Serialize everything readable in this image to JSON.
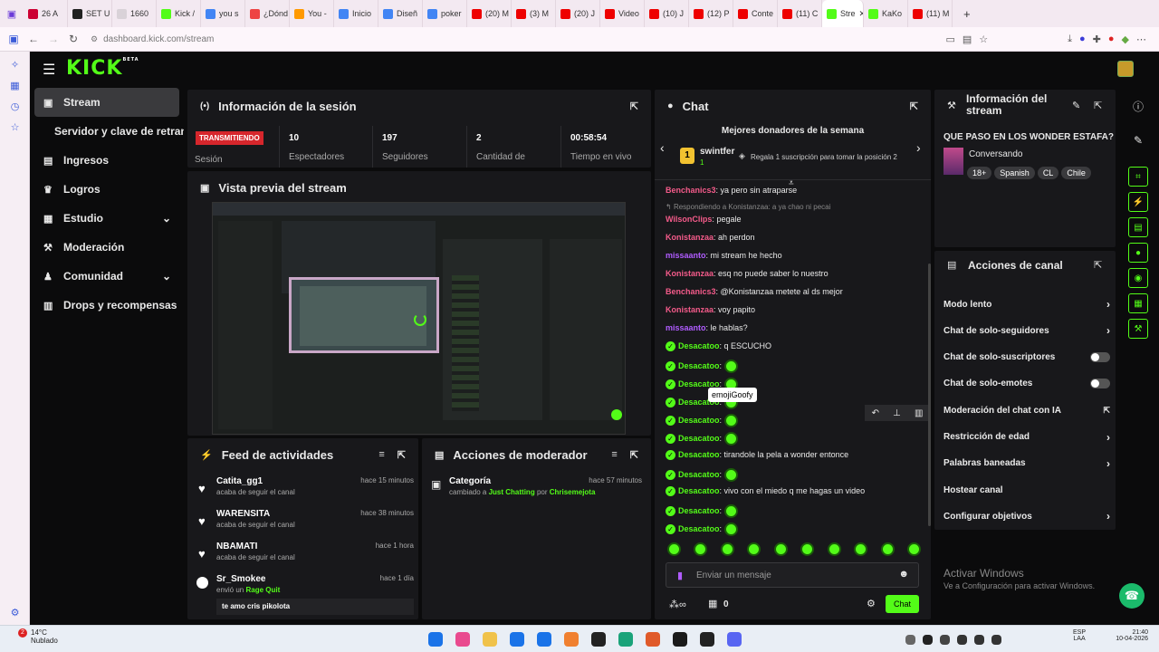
{
  "browser": {
    "tabs": [
      {
        "label": "26 A",
        "color": "#c03"
      },
      {
        "label": "SET U",
        "color": "#222"
      },
      {
        "label": "1660",
        "color": "#d9d2d8"
      },
      {
        "label": "Kick /",
        "color": "#53fc18"
      },
      {
        "label": "you s",
        "color": "#4285f4"
      },
      {
        "label": "¿Dónd",
        "color": "#e44"
      },
      {
        "label": "You -",
        "color": "#f90"
      },
      {
        "label": "Inicio",
        "color": "#4285f4"
      },
      {
        "label": "Diseñ",
        "color": "#4285f4"
      },
      {
        "label": "poker",
        "color": "#4285f4"
      },
      {
        "label": "(20) M",
        "color": "#e00"
      },
      {
        "label": "(3) M",
        "color": "#e00"
      },
      {
        "label": "(20) J",
        "color": "#e00"
      },
      {
        "label": "Video",
        "color": "#e00"
      },
      {
        "label": "(10) J",
        "color": "#e00"
      },
      {
        "label": "(12) P",
        "color": "#e00"
      },
      {
        "label": "Conte",
        "color": "#e00"
      },
      {
        "label": "(11) C",
        "color": "#e00"
      },
      {
        "label": "Stre",
        "color": "#53fc18",
        "active": true
      },
      {
        "label": "KaKo",
        "color": "#53fc18"
      },
      {
        "label": "(11) M",
        "color": "#e00"
      }
    ],
    "url": "dashboard.kick.com/stream"
  },
  "app": {
    "logo": "KICK",
    "logo_badge": "BETA"
  },
  "sidebar": {
    "items": [
      {
        "label": "Stream",
        "icon": "stream-icon",
        "active": true
      },
      {
        "label": "Servidor y clave de retransmisión",
        "icon": ""
      },
      {
        "label": "Ingresos",
        "icon": "revenue-icon"
      },
      {
        "label": "Logros",
        "icon": "trophy-icon"
      },
      {
        "label": "Estudio",
        "icon": "studio-icon",
        "chevron": true
      },
      {
        "label": "Moderación",
        "icon": "wrench-icon"
      },
      {
        "label": "Comunidad",
        "icon": "community-icon",
        "chevron": true
      },
      {
        "label": "Drops y recompensas",
        "icon": "gift-icon"
      }
    ]
  },
  "session": {
    "title": "Información de la sesión",
    "live_badge": "TRANSMITIENDO",
    "sesion_label": "Sesión",
    "stats": [
      {
        "value": "10",
        "label": "Espectadores"
      },
      {
        "value": "197",
        "label": "Seguidores"
      },
      {
        "value": "2",
        "label": "Cantidad de"
      },
      {
        "value": "00:58:54",
        "label": "Tiempo en vivo"
      }
    ]
  },
  "preview": {
    "title": "Vista previa del stream"
  },
  "feed": {
    "title": "Feed de actividades",
    "items": [
      {
        "name": "Catita_gg1",
        "sub": "acaba de seguir el canal",
        "time": "hace 15 minutos"
      },
      {
        "name": "WARENSITA",
        "sub": "acaba de seguir el canal",
        "time": "hace 38 minutos"
      },
      {
        "name": "NBAMATI",
        "sub": "acaba de seguir el canal",
        "time": "hace 1 hora"
      },
      {
        "name": "Sr_Smokee",
        "sub_pre": "envió un",
        "sub_link": "Rage Quit",
        "time": "hace 1 día",
        "msg": "te amo cris pikolota"
      }
    ]
  },
  "mod_actions": {
    "title": "Acciones de moderador",
    "items": [
      {
        "name": "Categoría",
        "pre": "cambiado a",
        "category": "Just Chatting",
        "by": "por",
        "user": "Chrisemejota",
        "time": "hace 57 minutos"
      }
    ]
  },
  "chat": {
    "title": "Chat",
    "donors_title": "Mejores donadores de la semana",
    "donor_rank": "1",
    "donor_name": "swintfer",
    "donor_count": "1",
    "donor_cta": "Regala 1 suscripción para tomar la posición 2",
    "reply_hint": "Respondiendo a Konistanzaa: a ya chao ni pecai",
    "tooltip": "emojiGoofy",
    "messages": [
      {
        "user": "Benchanics3",
        "cls": "u-pink",
        "text": "ya pero sin atraparse"
      },
      {
        "user": "WilsonClips",
        "cls": "u-pink",
        "text": "pegale",
        "reply": true
      },
      {
        "user": "Konistanzaa",
        "cls": "u-pink",
        "text": "ah perdon"
      },
      {
        "user": "missaanto",
        "cls": "u-purple",
        "text": "mi stream he hecho"
      },
      {
        "user": "Konistanzaa",
        "cls": "u-pink",
        "text": "esq no puede saber lo nuestro"
      },
      {
        "user": "Benchanics3",
        "cls": "u-pink",
        "text": "@Konistanzaa metete al ds mejor"
      },
      {
        "user": "Konistanzaa",
        "cls": "u-pink",
        "text": "voy papito"
      },
      {
        "user": "missaanto",
        "cls": "u-purple",
        "text": "le hablas?"
      },
      {
        "user": "Desacatoo",
        "cls": "u-green",
        "text": "q ESCUCHO",
        "badge": true
      },
      {
        "user": "Desacatoo",
        "cls": "u-green",
        "text": "",
        "badge": true,
        "emote": true
      },
      {
        "user": "Desacatoo",
        "cls": "u-green",
        "text": "",
        "badge": true,
        "emote": true
      },
      {
        "user": "Desacatoo",
        "cls": "u-green",
        "text": "",
        "badge": true,
        "emote": true
      },
      {
        "user": "Desacatoo",
        "cls": "u-green",
        "text": "",
        "badge": true,
        "emote": true
      },
      {
        "user": "Desacatoo",
        "cls": "u-green",
        "text": "",
        "badge": true,
        "emote": true
      },
      {
        "user": "Desacatoo",
        "cls": "u-green",
        "text": "tirandole la pela a wonder entonce",
        "badge": true
      },
      {
        "user": "Desacatoo",
        "cls": "u-green",
        "text": "",
        "badge": true,
        "emote": true
      },
      {
        "user": "Desacatoo",
        "cls": "u-green",
        "text": "vivo con el miedo q me hagas un video",
        "badge": true
      },
      {
        "user": "Desacatoo",
        "cls": "u-green",
        "text": "",
        "badge": true,
        "emote": true
      },
      {
        "user": "Desacatoo",
        "cls": "u-green",
        "text": "",
        "badge": true,
        "emote": true
      }
    ],
    "input_placeholder": "Enviar un mensaje",
    "points": "0",
    "send_label": "Chat"
  },
  "stream_info": {
    "title": "Información del stream",
    "stream_title": "QUE PASO EN LOS WONDER ESTAFA?",
    "category": "Conversando",
    "tags": [
      "18+",
      "Spanish",
      "CL",
      "Chile"
    ]
  },
  "channel_actions": {
    "title": "Acciones de canal",
    "items": [
      {
        "label": "Modo lento",
        "type": "chevron"
      },
      {
        "label": "Chat de solo-seguidores",
        "type": "chevron"
      },
      {
        "label": "Chat de solo-suscriptores",
        "type": "toggle"
      },
      {
        "label": "Chat de solo-emotes",
        "type": "toggle"
      },
      {
        "label": "Moderación del chat con IA",
        "type": "external"
      },
      {
        "label": "Restricción de edad",
        "type": "chevron"
      },
      {
        "label": "Palabras baneadas",
        "type": "chevron"
      },
      {
        "label": "Hostear canal",
        "type": "none"
      },
      {
        "label": "Configurar objetivos",
        "type": "chevron"
      }
    ]
  },
  "windows_watermark": {
    "line1": "Activar Windows",
    "line2": "Ve a Configuración para activar Windows."
  },
  "taskbar": {
    "weather_temp": "14°C",
    "weather_desc": "Nublado",
    "notif_count": "2",
    "lang1": "ESP",
    "lang2": "LAA",
    "time": "21:40",
    "date": "10-04-2026"
  }
}
